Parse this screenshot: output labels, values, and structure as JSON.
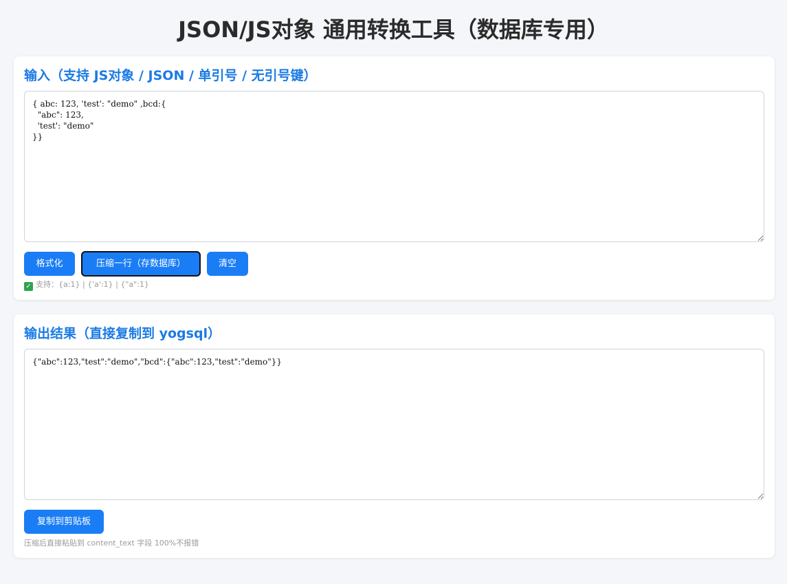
{
  "page": {
    "title": "JSON/JS对象 通用转换工具（数据库专用）"
  },
  "input_section": {
    "title": "输入（支持 JS对象 / JSON / 单引号 / 无引号键）",
    "value": "{ abc: 123, 'test': \"demo\" ,bcd:{\n  \"abc\": 123,\n  'test': \"demo\"\n}}",
    "buttons": {
      "format": "格式化",
      "compress": "压缩一行（存数据库）",
      "clear": "清空"
    },
    "hint": "支持：{a:1} | {'a':1} | {\"a\":1}"
  },
  "output_section": {
    "title": "输出结果（直接复制到 yogsql）",
    "value": "{\"abc\":123,\"test\":\"demo\",\"bcd\":{\"abc\":123,\"test\":\"demo\"}}",
    "buttons": {
      "copy": "复制到剪贴板"
    },
    "hint": "压缩后直接粘贴到 content_text 字段 100%不报错"
  },
  "colors": {
    "accent": "#1a7df5",
    "section_title": "#1a7ae6",
    "background": "#f4f6f9"
  },
  "icons": {
    "hint_check": "check-mark-icon"
  }
}
